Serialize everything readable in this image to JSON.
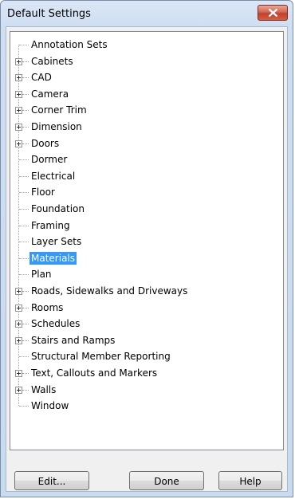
{
  "window": {
    "title": "Default Settings"
  },
  "tree": {
    "items": [
      {
        "label": "Annotation Sets",
        "expandable": false
      },
      {
        "label": "Cabinets",
        "expandable": true
      },
      {
        "label": "CAD",
        "expandable": true
      },
      {
        "label": "Camera",
        "expandable": true
      },
      {
        "label": "Corner Trim",
        "expandable": true
      },
      {
        "label": "Dimension",
        "expandable": true
      },
      {
        "label": "Doors",
        "expandable": true
      },
      {
        "label": "Dormer",
        "expandable": false
      },
      {
        "label": "Electrical",
        "expandable": false
      },
      {
        "label": "Floor",
        "expandable": false
      },
      {
        "label": "Foundation",
        "expandable": false
      },
      {
        "label": "Framing",
        "expandable": false
      },
      {
        "label": "Layer Sets",
        "expandable": false
      },
      {
        "label": "Materials",
        "expandable": false,
        "selected": true
      },
      {
        "label": "Plan",
        "expandable": false
      },
      {
        "label": "Roads, Sidewalks and Driveways",
        "expandable": true
      },
      {
        "label": "Rooms",
        "expandable": true
      },
      {
        "label": "Schedules",
        "expandable": true
      },
      {
        "label": "Stairs and Ramps",
        "expandable": true
      },
      {
        "label": "Structural Member Reporting",
        "expandable": false
      },
      {
        "label": "Text, Callouts and Markers",
        "expandable": true
      },
      {
        "label": "Walls",
        "expandable": true
      },
      {
        "label": "Window",
        "expandable": false
      }
    ]
  },
  "buttons": {
    "edit": "Edit...",
    "done": "Done",
    "help": "Help"
  },
  "colors": {
    "selection": "#3399ff",
    "close_button": "#c7472f"
  }
}
